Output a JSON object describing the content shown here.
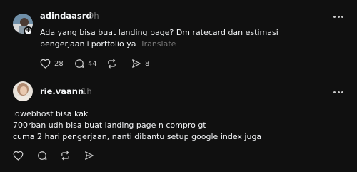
{
  "main_post": {
    "username": "adindaasrd",
    "time": "9h",
    "text_line1": "Ada yang bisa buat landing page? Dm ratecard dan estimasi",
    "text_line2": "pengerjaan+portfolio ya",
    "translate_label": "Translate",
    "likes": "28",
    "comments": "44",
    "shares": "8",
    "icons": [
      "heart-icon",
      "comment-icon",
      "repost-icon",
      "share-icon",
      "more-icon"
    ]
  },
  "reply_post": {
    "username": "rie.vaann",
    "time": "1h",
    "text_line1": "idwebhost bisa kak",
    "text_line2": "700rban udh bisa buat landing page n compro gt",
    "text_line3": "cuma 2 hari pengerjaan, nanti dibantu setup google index juga",
    "icons": [
      "heart-icon",
      "comment-icon",
      "repost-icon",
      "share-icon",
      "more-icon"
    ]
  },
  "colors": {
    "background": "#101010",
    "text": "#f3f5f7",
    "muted": "#777777",
    "divider": "#2a2a2a"
  }
}
